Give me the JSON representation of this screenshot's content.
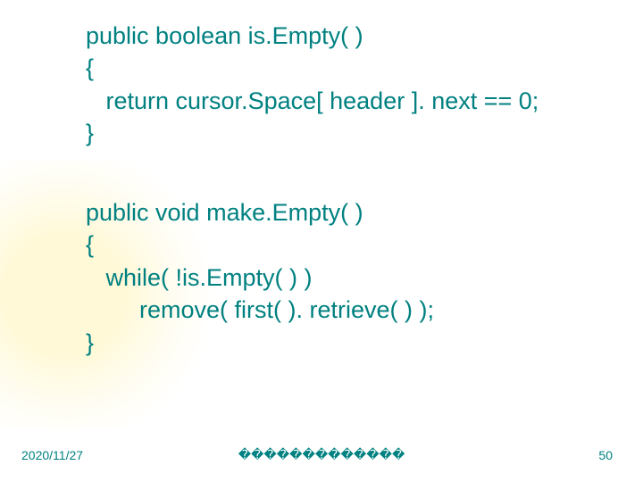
{
  "code": {
    "block1": {
      "l1": "public boolean is.Empty( )",
      "l2": "{",
      "l3": "   return cursor.Space[ header ]. next == 0;",
      "l4": "}"
    },
    "block2": {
      "l1": "public void make.Empty( )",
      "l2": "{",
      "l3": "   while( !is.Empty( ) )",
      "l4": "        remove( first( ). retrieve( ) );",
      "l5": "}"
    }
  },
  "footer": {
    "date": "2020/11/27",
    "center": "�������������",
    "page": "50"
  }
}
